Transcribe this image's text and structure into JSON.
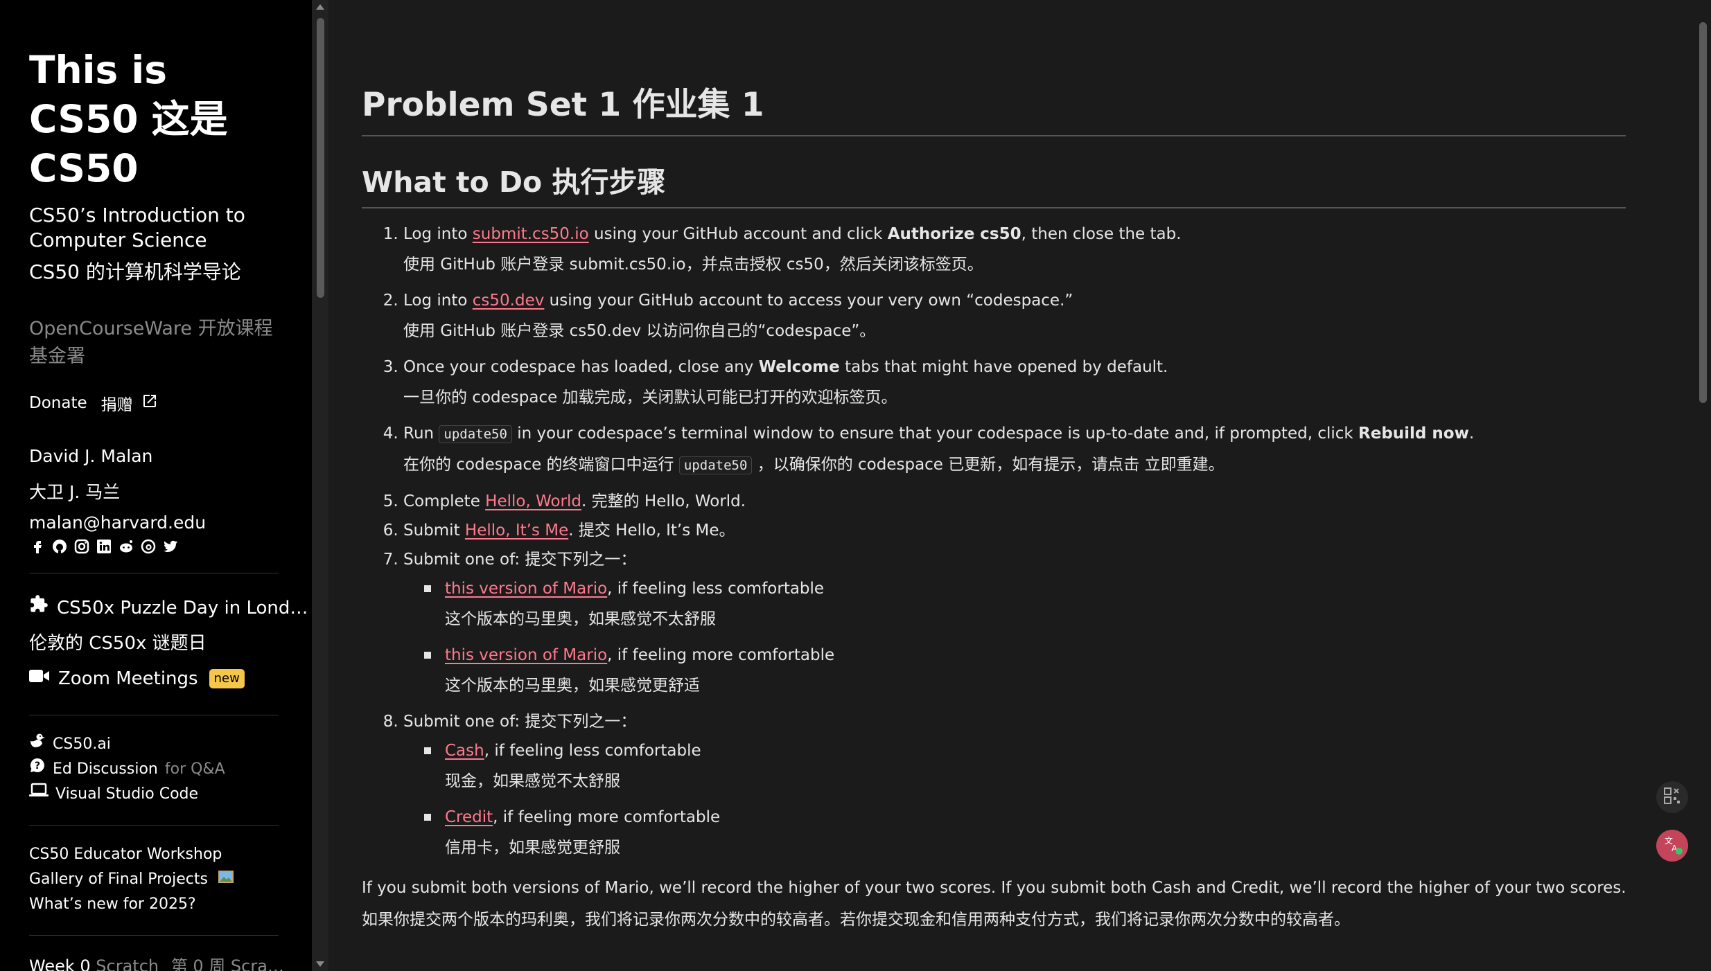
{
  "sidebar": {
    "title_line1": "This is",
    "title_line2": "CS50  这是",
    "title_line3": "CS50",
    "subtitle_en_1": "CS50’s Introduction to",
    "subtitle_en_2": "Computer Science",
    "subtitle_cn": "CS50 的计算机科学导论",
    "ocw": "OpenCourseWare  开放课程基金署",
    "donate_en": "Donate",
    "donate_cn": "捐赠",
    "author_en": "David J. Malan",
    "author_cn": "大卫 J. 马兰",
    "email": "malan@harvard.edu",
    "social_icons": [
      "facebook-icon",
      "github-icon",
      "instagram-icon",
      "linkedin-icon",
      "reddit-icon",
      "threads-icon",
      "twitter-icon"
    ],
    "puzzle_day": "CS50x Puzzle Day in Lond…",
    "puzzle_day_cn": "伦敦的 CS50x 谜题日",
    "zoom": "Zoom Meetings",
    "zoom_badge": "new",
    "cs50ai": "CS50.ai",
    "ed": "Ed Discussion",
    "ed_suffix": "for Q&A",
    "vscode": "Visual Studio Code",
    "workshop": "CS50 Educator Workshop",
    "gallery": "Gallery of Final Projects",
    "whatsnew": "What’s new for 2025?",
    "week_prefix": "Week 0",
    "week_topic": "Scratch",
    "week_cn": "第 0 周 Scra…"
  },
  "main": {
    "h1": "Problem Set 1  作业集 1",
    "h2": "What to Do  执行步骤",
    "steps": [
      {
        "en_a": "Log into ",
        "link": "submit.cs50.io",
        "en_b": " using your GitHub account and click ",
        "bold": "Authorize cs50",
        "en_c": ", then close the tab.",
        "cn": "使用 GitHub 账户登录 submit.cs50.io，并点击授权 cs50，然后关闭该标签页。"
      },
      {
        "en_a": "Log into ",
        "link": "cs50.dev",
        "en_b": " using your GitHub account to access your very own “codespace.”",
        "cn": "使用 GitHub 账户登录 cs50.dev 以访问你自己的“codespace”。"
      },
      {
        "en_a": "Once your codespace has loaded, close any ",
        "bold": "Welcome",
        "en_b": " tabs that might have opened by default.",
        "cn": "一旦你的 codespace 加载完成，关闭默认可能已打开的欢迎标签页。"
      },
      {
        "en_a": "Run ",
        "code": "update50",
        "en_b": " in your codespace’s terminal window to ensure that your codespace is up-to-date and, if prompted, click ",
        "bold": "Rebuild now",
        "en_c": ".",
        "cn_a": "在你的 codespace 的终端窗口中运行 ",
        "cn_code": "update50",
        "cn_b": " ，以确保你的 codespace 已更新，如有提示，请点击 立即重建。"
      },
      {
        "en_a": "Complete ",
        "link": "Hello, World",
        "en_b": ".  完整的 Hello, World."
      },
      {
        "en_a": "Submit ",
        "link": "Hello, It’s Me",
        "en_b": ".  提交 Hello, It’s Me。"
      },
      {
        "en": "Submit one of:  提交下列之一：",
        "sub": [
          {
            "link": "this version of Mario",
            "en": ", if feeling less comfortable",
            "cn": "这个版本的马里奥，如果感觉不太舒服"
          },
          {
            "link": "this version of Mario",
            "en": ", if feeling more comfortable",
            "cn": "这个版本的马里奥，如果感觉更舒适"
          }
        ]
      },
      {
        "en": "Submit one of:  提交下列之一：",
        "sub": [
          {
            "link": "Cash",
            "en": ", if feeling less comfortable",
            "cn": "现金，如果感觉不太舒服"
          },
          {
            "link": "Credit",
            "en": ", if feeling more comfortable",
            "cn": "信用卡，如果感觉更舒服"
          }
        ]
      }
    ],
    "para_en": "If you submit both versions of Mario, we’ll record the higher of your two scores. If you submit both Cash and Credit, we’ll record the higher of your two scores.",
    "para_cn": "如果你提交两个版本的玛利奥，我们将记录你两次分数中的较高者。若你提交现金和信用两种支付方式，我们将记录你两次分数中的较高者。"
  },
  "colors": {
    "link": "#ff7a8e",
    "badge": "#f4c64a",
    "bg_main": "#1b1b1b",
    "bg_sidebar": "#000000"
  }
}
